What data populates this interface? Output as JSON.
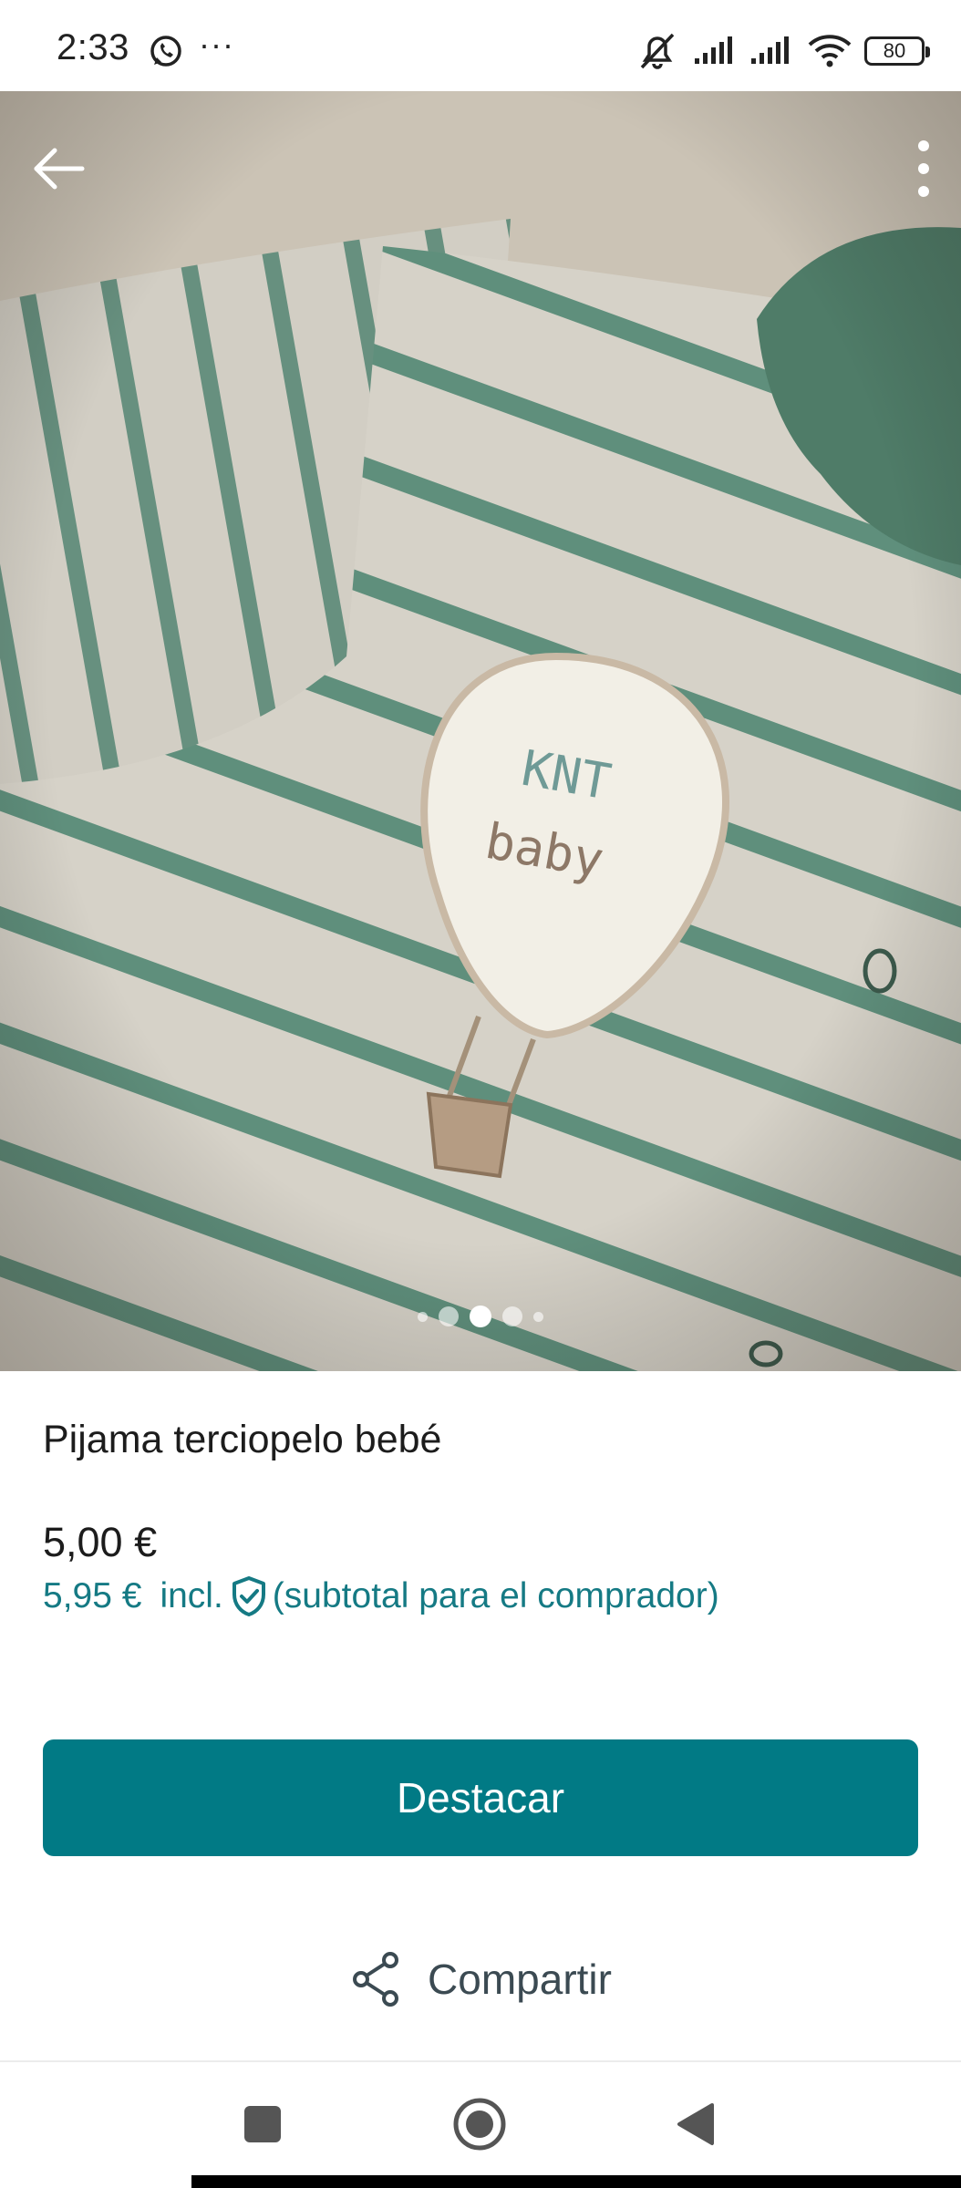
{
  "status_bar": {
    "time": "2:33",
    "more": "···",
    "battery": "80",
    "icons": [
      "whatsapp-icon",
      "mute-icon",
      "signal-icon",
      "signal-icon",
      "wifi-icon",
      "battery-icon"
    ]
  },
  "photo": {
    "pages_total": 5,
    "active_page": 3,
    "icons": [
      "back-arrow-icon",
      "more-vert-icon"
    ]
  },
  "product": {
    "title": "Pijama terciopelo bebé",
    "price": "5,00 €",
    "buyer_price": "5,95 €",
    "incl_label": "incl.",
    "buyer_note": "(subtotal para el comprador)"
  },
  "actions": {
    "featured_label": "Destacar",
    "share_label": "Compartir"
  },
  "colors": {
    "accent": "#017a85",
    "buyer_text": "#157a84"
  }
}
